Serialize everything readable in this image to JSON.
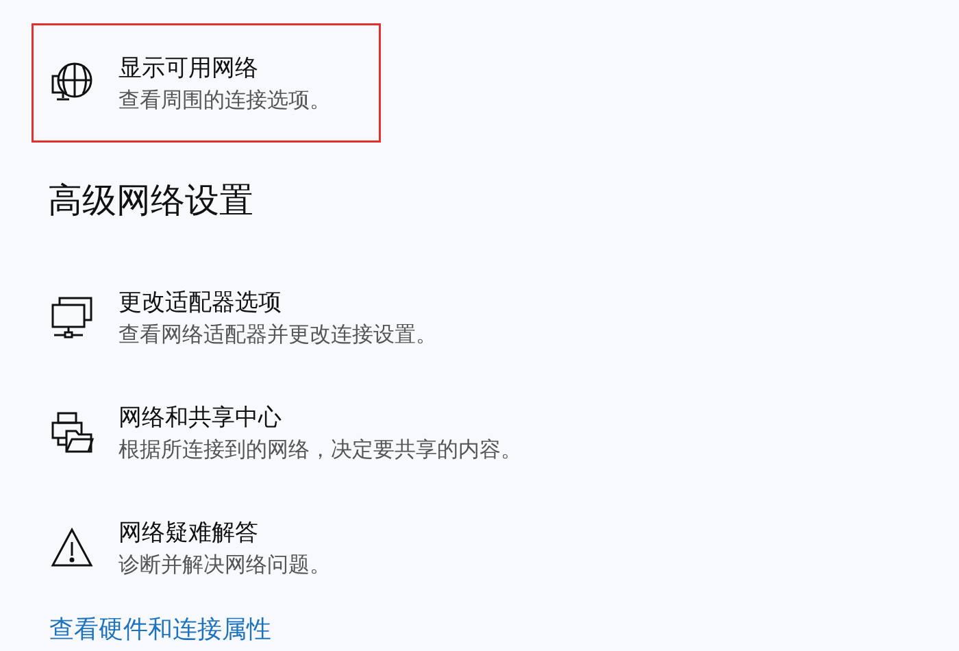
{
  "top_items": [
    {
      "kind": "globe",
      "title": "显示可用网络",
      "description": "查看周围的连接选项。",
      "highlighted": true
    }
  ],
  "section": {
    "heading": "高级网络设置",
    "items": [
      {
        "kind": "adapter",
        "title": "更改适配器选项",
        "description": "查看网络适配器并更改连接设置。",
        "highlighted": false
      },
      {
        "kind": "sharing",
        "title": "网络和共享中心",
        "description": "根据所连接到的网络，决定要共享的内容。",
        "highlighted": false
      },
      {
        "kind": "warning",
        "title": "网络疑难解答",
        "description": "诊断并解决网络问题。",
        "highlighted": false
      }
    ],
    "link": "查看硬件和连接属性"
  }
}
